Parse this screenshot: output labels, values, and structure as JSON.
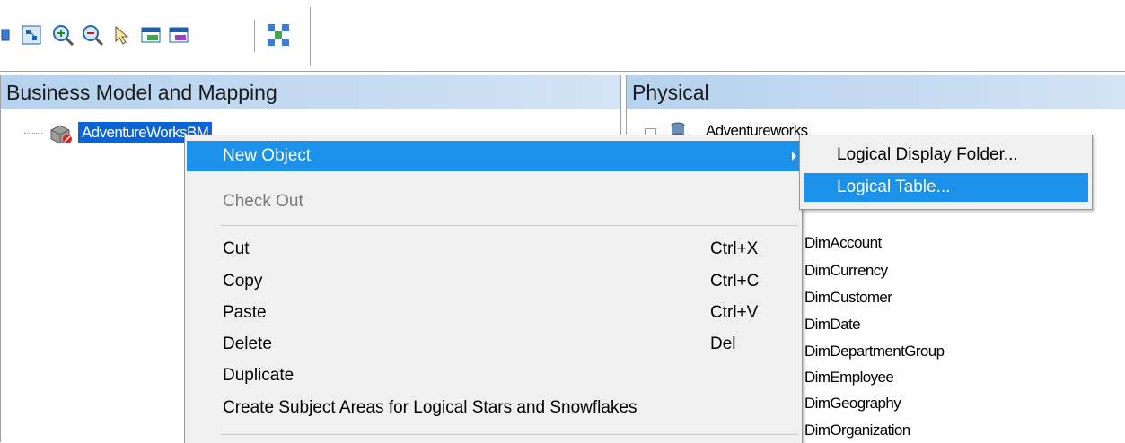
{
  "toolbar": {
    "buttons": [
      {
        "name": "partial-tool-icon"
      },
      {
        "name": "layout-icon"
      },
      {
        "name": "zoom-in-icon"
      },
      {
        "name": "zoom-out-icon"
      },
      {
        "name": "select-icon"
      },
      {
        "name": "table-icon"
      },
      {
        "name": "table-join-icon"
      },
      {
        "name": "diagram-icon"
      }
    ]
  },
  "left_pane": {
    "title": "Business Model and Mapping",
    "root_item": "AdventureWorksBM"
  },
  "right_pane": {
    "title": "Physical",
    "root_item": "Adventureworks",
    "tables": [
      "DimAccount",
      "DimCurrency",
      "DimCustomer",
      "DimDate",
      "DimDepartmentGroup",
      "DimEmployee",
      "DimGeography",
      "DimOrganization"
    ]
  },
  "context_menu": {
    "new_object": "New Object",
    "check_out": "Check Out",
    "items": [
      {
        "label": "Cut",
        "shortcut": "Ctrl+X"
      },
      {
        "label": "Copy",
        "shortcut": "Ctrl+C"
      },
      {
        "label": "Paste",
        "shortcut": "Ctrl+V"
      },
      {
        "label": "Delete",
        "shortcut": "Del"
      },
      {
        "label": "Duplicate",
        "shortcut": ""
      },
      {
        "label": "Create Subject Areas for Logical Stars and Snowflakes",
        "shortcut": ""
      }
    ]
  },
  "submenu": {
    "items": [
      "Logical Display Folder...",
      "Logical Table..."
    ]
  },
  "colors": {
    "highlight": "#1b91ea",
    "selection": "#0a64d6",
    "header_gradient": "#b6d2ee"
  }
}
